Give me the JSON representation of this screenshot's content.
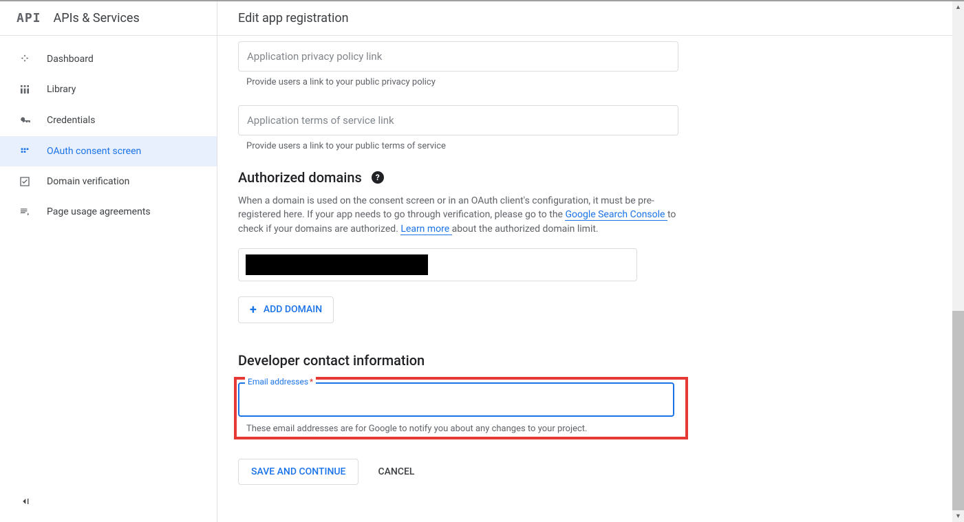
{
  "sidebar": {
    "logo_text": "API",
    "title": "APIs & Services",
    "items": [
      {
        "label": "Dashboard"
      },
      {
        "label": "Library"
      },
      {
        "label": "Credentials"
      },
      {
        "label": "OAuth consent screen"
      },
      {
        "label": "Domain verification"
      },
      {
        "label": "Page usage agreements"
      }
    ]
  },
  "page": {
    "title": "Edit app registration"
  },
  "privacy": {
    "placeholder": "Application privacy policy link",
    "helper": "Provide users a link to your public privacy policy"
  },
  "terms": {
    "placeholder": "Application terms of service link",
    "helper": "Provide users a link to your public terms of service"
  },
  "authorized": {
    "heading": "Authorized domains",
    "desc_part1": "When a domain is used on the consent screen or in an OAuth client's configuration, it must be pre-registered here. If your app needs to go through verification, please go to the ",
    "link1": "Google Search Console ",
    "desc_part2": "to check if your domains are authorized. ",
    "link2": "Learn more ",
    "desc_part3": "about the authorized domain limit.",
    "add_button": "ADD DOMAIN"
  },
  "developer": {
    "heading": "Developer contact information",
    "email_label": "Email addresses",
    "email_helper": "These email addresses are for Google to notify you about any changes to your project."
  },
  "buttons": {
    "save": "SAVE AND CONTINUE",
    "cancel": "CANCEL"
  }
}
